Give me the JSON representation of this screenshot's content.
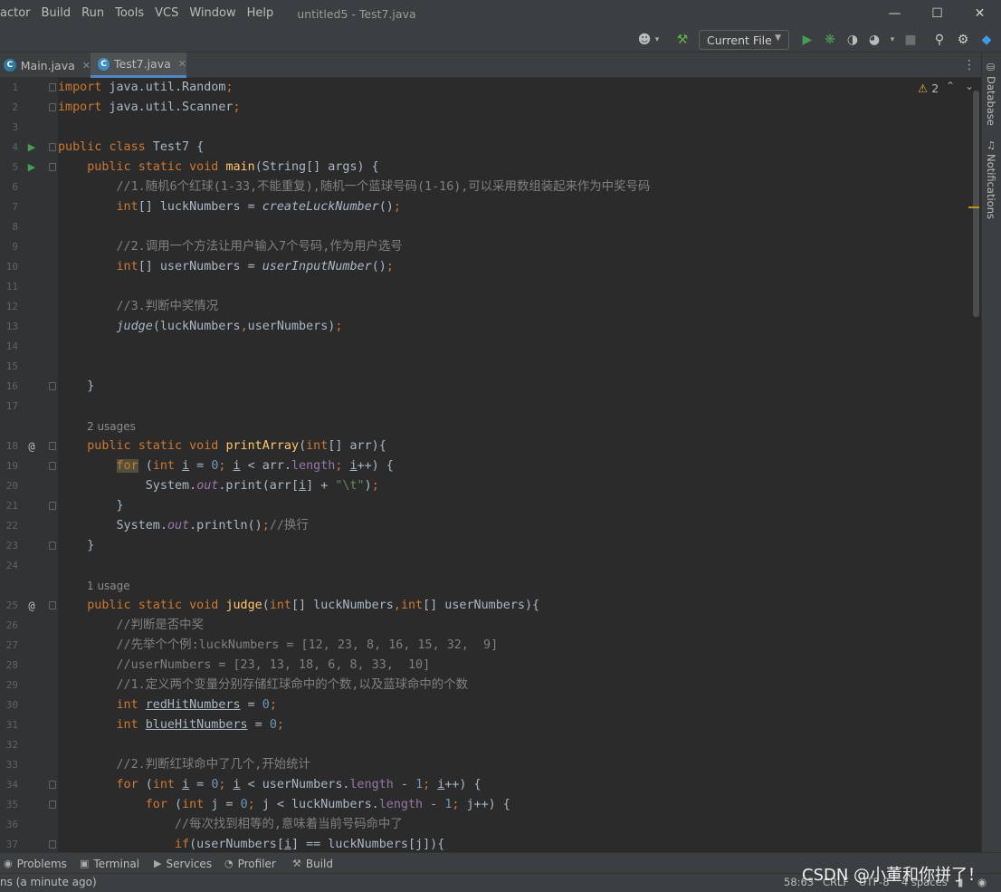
{
  "menu": [
    "actor",
    "Build",
    "Run",
    "Tools",
    "VCS",
    "Window",
    "Help"
  ],
  "window_title": "untitled5 - Test7.java",
  "toolbar": {
    "run_config": "Current File"
  },
  "tabs": [
    {
      "label": "Main.java",
      "active": false
    },
    {
      "label": "Test7.java",
      "active": true
    }
  ],
  "inspection": {
    "warnings": "2"
  },
  "right_stripe": {
    "database": "Database",
    "notifications": "Notifications"
  },
  "hints": {
    "printArray_usages": "2 usages",
    "judge_usages": "1 usage"
  },
  "code_lines": [
    "import java.util.Random;",
    "import java.util.Scanner;",
    "",
    "public class Test7 {",
    "    public static void main(String[] args) {",
    "        //1.随机6个红球(1-33,不能重复),随机一个蓝球号码(1-16),可以采用数组装起来作为中奖号码",
    "        int[] luckNumbers = createLuckNumber();",
    "",
    "        //2.调用一个方法让用户输入7个号码,作为用户选号",
    "        int[] userNumbers = userInputNumber();",
    "",
    "        //3.判断中奖情况",
    "        judge(luckNumbers,userNumbers);",
    "",
    "",
    "    }",
    "",
    "    public static void printArray(int[] arr){",
    "        for (int i = 0; i < arr.length; i++) {",
    "            System.out.print(arr[i] + \"\\t\");",
    "        }",
    "        System.out.println();//换行",
    "    }",
    "",
    "    public static void judge(int[] luckNumbers,int[] userNumbers){",
    "        //判断是否中奖",
    "        //先举个个例:luckNumbers = [12, 23, 8, 16, 15, 32,  9]",
    "        //userNumbers = [23, 13, 18, 6, 8, 33,  10]",
    "        //1.定义两个变量分别存储红球命中的个数,以及蓝球命中的个数",
    "        int redHitNumbers = 0;",
    "        int blueHitNumbers = 0;",
    "",
    "        //2.判断红球命中了几个,开始统计",
    "        for (int i = 0; i < userNumbers.length - 1; i++) {",
    "            for (int j = 0; j < luckNumbers.length - 1; j++) {",
    "                //每次找到相等的,意味着当前号码命中了",
    "                if(userNumbers[i] == luckNumbers[j]){"
  ],
  "bottom_tools": [
    "Problems",
    "Terminal",
    "Services",
    "Profiler",
    "Build"
  ],
  "status": {
    "message": "ns (a minute ago)",
    "position": "58:63",
    "line_sep": "CRLF",
    "encoding": "UTF-8",
    "indent": "4 spaces"
  },
  "watermark": "CSDN @小董和你拼了！",
  "colors": {
    "keyword": "#cc7832",
    "function": "#ffc66d",
    "comment": "#808080",
    "number": "#6897bb",
    "string": "#6a8759",
    "static_field": "#9876aa",
    "background": "#2b2b2b"
  }
}
